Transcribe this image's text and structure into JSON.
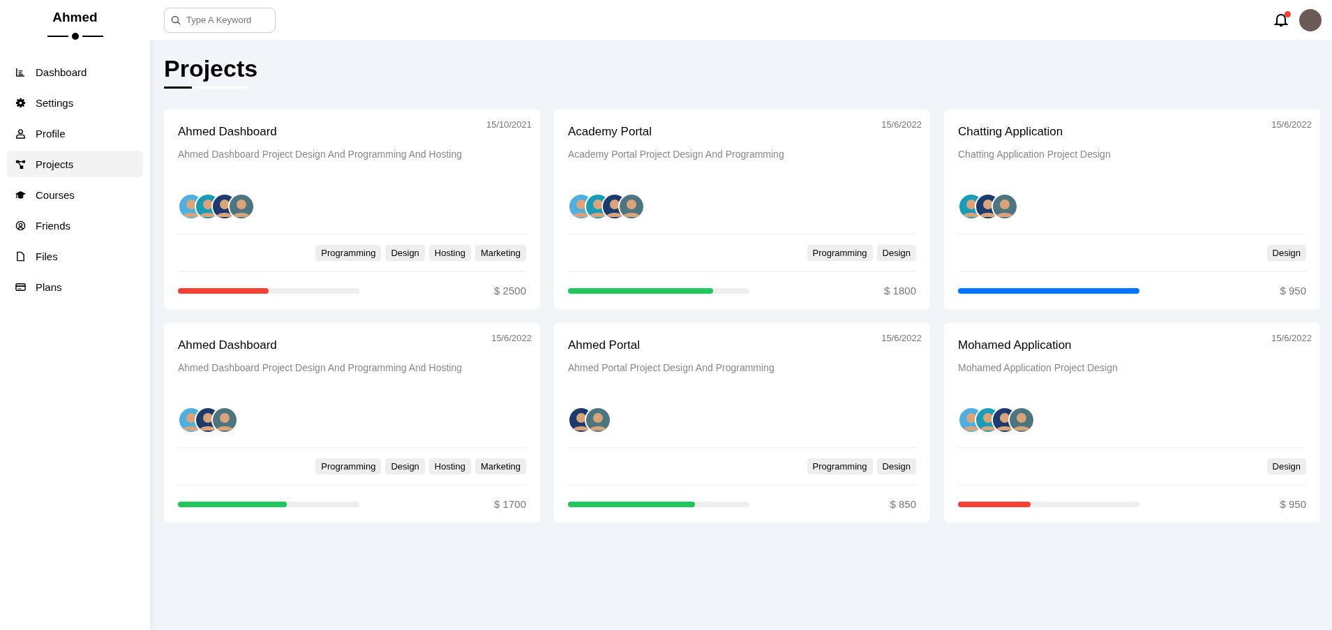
{
  "sidebar": {
    "title": "Ahmed",
    "items": [
      {
        "label": "Dashboard",
        "kind": "chart",
        "selected": false
      },
      {
        "label": "Settings",
        "kind": "gear",
        "selected": false
      },
      {
        "label": "Profile",
        "kind": "user",
        "selected": false
      },
      {
        "label": "Projects",
        "kind": "nodes",
        "selected": true
      },
      {
        "label": "Courses",
        "kind": "cap",
        "selected": false
      },
      {
        "label": "Friends",
        "kind": "user-circle",
        "selected": false
      },
      {
        "label": "Files",
        "kind": "file",
        "selected": false
      },
      {
        "label": "Plans",
        "kind": "card",
        "selected": false
      }
    ]
  },
  "search": {
    "placeholder": "Type A Keyword"
  },
  "notifications": {
    "unread": true
  },
  "page_title": "Projects",
  "projects": [
    {
      "title": "Ahmed Dashboard",
      "date": "15/10/2021",
      "description": "Ahmed Dashboard Project Design And Programming And Hosting",
      "avatars": [
        {
          "color": "#4fb0e0"
        },
        {
          "color": "#1a9bb8"
        },
        {
          "color": "#1c3a6b"
        },
        {
          "color": "#4d7580"
        }
      ],
      "tags": [
        "Programming",
        "Design",
        "Hosting",
        "Marketing"
      ],
      "level": 0.5,
      "color": "#f44336",
      "price": "$ 2500"
    },
    {
      "title": "Academy Portal",
      "date": "15/6/2022",
      "description": "Academy Portal Project Design And Programming",
      "avatars": [
        {
          "color": "#4fb0e0"
        },
        {
          "color": "#1a9bb8"
        },
        {
          "color": "#1c3a6b"
        },
        {
          "color": "#4d7580"
        }
      ],
      "tags": [
        "Programming",
        "Design"
      ],
      "level": 0.8,
      "color": "#22c55e",
      "price": "$ 1800"
    },
    {
      "title": "Chatting Application",
      "date": "15/6/2022",
      "description": "Chatting Application Project Design",
      "avatars": [
        {
          "color": "#1a9bb8"
        },
        {
          "color": "#1c3a6b"
        },
        {
          "color": "#4d7580"
        }
      ],
      "tags": [
        "Design"
      ],
      "level": 1.0,
      "color": "#0075ff",
      "price": "$ 950"
    },
    {
      "title": "Ahmed Dashboard",
      "date": "15/6/2022",
      "description": "Ahmed Dashboard Project Design And Programming And Hosting",
      "avatars": [
        {
          "color": "#4fb0e0"
        },
        {
          "color": "#1c3a6b"
        },
        {
          "color": "#4d7580"
        }
      ],
      "tags": [
        "Programming",
        "Design",
        "Hosting",
        "Marketing"
      ],
      "level": 0.6,
      "color": "#22c55e",
      "price": "$ 1700"
    },
    {
      "title": "Ahmed Portal",
      "date": "15/6/2022",
      "description": "Ahmed Portal Project Design And Programming",
      "avatars": [
        {
          "color": "#1c3a6b"
        },
        {
          "color": "#4d7580"
        }
      ],
      "tags": [
        "Programming",
        "Design"
      ],
      "level": 0.7,
      "color": "#22c55e",
      "price": "$ 850"
    },
    {
      "title": "Mohamed Application",
      "date": "15/6/2022",
      "description": "Mohamed Application Project Design",
      "avatars": [
        {
          "color": "#4fb0e0"
        },
        {
          "color": "#1a9bb8"
        },
        {
          "color": "#1c3a6b"
        },
        {
          "color": "#4d7580"
        }
      ],
      "tags": [
        "Design"
      ],
      "level": 0.4,
      "color": "#f44336",
      "price": "$ 950"
    }
  ]
}
